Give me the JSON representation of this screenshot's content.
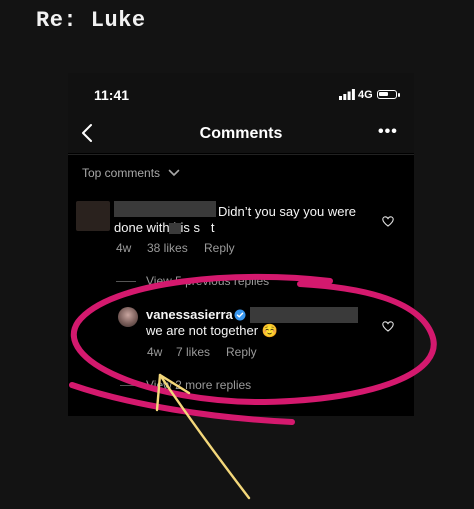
{
  "caption": "Re: Luke",
  "status_bar": {
    "time": "11:41",
    "network": "4G"
  },
  "header": {
    "title": "Comments",
    "more": "•••"
  },
  "sort": {
    "label": "Top comments"
  },
  "comments": [
    {
      "text_line1": "Didn’t you say you were",
      "text_line2": "done with his s   t",
      "age": "4w",
      "likes": "38 likes",
      "reply": "Reply"
    },
    {
      "view_replies": "View 5 previous replies"
    },
    {
      "username": "vanessasierra",
      "verified": true,
      "text": "we are not together ☺️",
      "age": "4w",
      "likes": "7 likes",
      "reply": "Reply",
      "view_more": "View 2 more replies"
    }
  ],
  "colors": {
    "annotation_circle": "#d4196e",
    "arrow": "#f3d77a",
    "verified": "#3897f0",
    "background": "#131313",
    "phone_bg": "#000000"
  }
}
